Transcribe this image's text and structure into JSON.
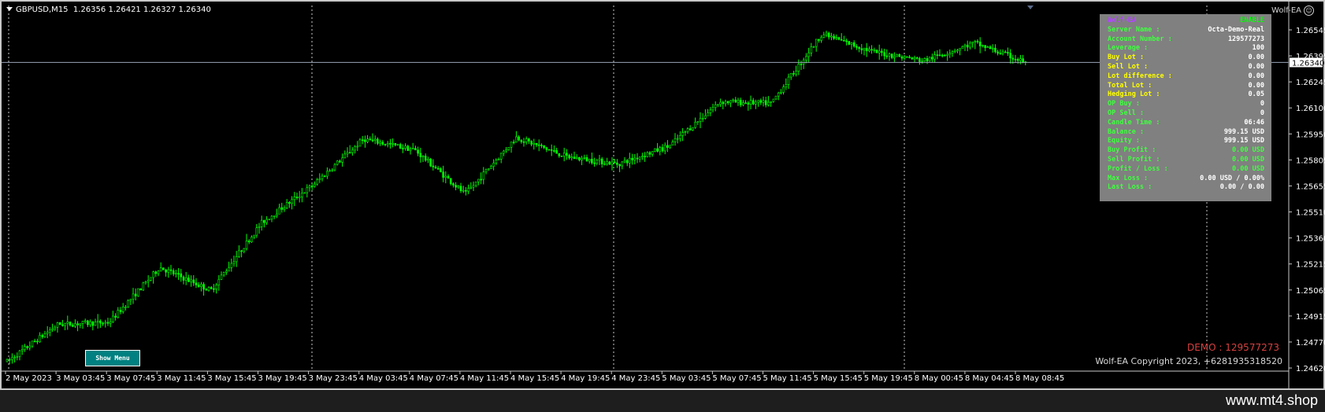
{
  "chart_header": {
    "symbol": "GBPUSD,M15",
    "ohlc": "1.26356 1.26421 1.26327 1.26340"
  },
  "ea_tag": {
    "label": "Wolf-EA",
    "icon": "smiley-icon"
  },
  "colors": {
    "background": "#000000",
    "candle": "#00ff00",
    "grid": "#c8c8c8",
    "bid_line": "#9aa5b8",
    "panel_bg": "#808080",
    "menu_button_bg": "#008080",
    "demo_text": "#d84040"
  },
  "info_panel": {
    "rows": [
      {
        "label": "Wolf-EA",
        "value": "ENABLE",
        "label_color": "#b040ff",
        "value_color": "#00ff00"
      },
      {
        "label": "Server Name :",
        "value": "Octa-Demo-Real",
        "label_color": "#40ff40",
        "value_color": "#ffffff"
      },
      {
        "label": "Account Number :",
        "value": "129577273",
        "label_color": "#40ff40",
        "value_color": "#ffffff"
      },
      {
        "label": "Leverage :",
        "value": "100",
        "label_color": "#40ff40",
        "value_color": "#ffffff"
      },
      {
        "label": "Buy Lot :",
        "value": "0.00",
        "label_color": "#ffff00",
        "value_color": "#ffffff"
      },
      {
        "label": "Sell Lot :",
        "value": "0.00",
        "label_color": "#ffff00",
        "value_color": "#ffffff"
      },
      {
        "label": "Lot difference :",
        "value": "0.00",
        "label_color": "#ffff00",
        "value_color": "#ffffff"
      },
      {
        "label": "Total Lot :",
        "value": "0.00",
        "label_color": "#ffff00",
        "value_color": "#ffffff"
      },
      {
        "label": "Hedging Lot :",
        "value": "0.05",
        "label_color": "#ffff00",
        "value_color": "#ffffff"
      },
      {
        "label": "OP Buy :",
        "value": "0",
        "label_color": "#40ff40",
        "value_color": "#ffffff"
      },
      {
        "label": "OP Sell :",
        "value": "0",
        "label_color": "#40ff40",
        "value_color": "#ffffff"
      },
      {
        "label": "Candle Time :",
        "value": "06:46",
        "label_color": "#40ff40",
        "value_color": "#ffffff"
      },
      {
        "label": "Balance :",
        "value": "999.15 USD",
        "label_color": "#40ff40",
        "value_color": "#ffffff"
      },
      {
        "label": "Equity :",
        "value": "999.15 USD",
        "label_color": "#40ff40",
        "value_color": "#ffffff"
      },
      {
        "label": "Buy Profit :",
        "value": "0.00 USD",
        "label_color": "#40ff40",
        "value_color": "#40ff40"
      },
      {
        "label": "Sell Profit :",
        "value": "0.00 USD",
        "label_color": "#40ff40",
        "value_color": "#40ff40"
      },
      {
        "label": "Profit / Loss :",
        "value": "0.00 USD",
        "label_color": "#40ff40",
        "value_color": "#40ff40"
      },
      {
        "label": "Max Loss :",
        "value": "0.00 USD / 0.00%",
        "label_color": "#40ff40",
        "value_color": "#ffffff"
      },
      {
        "label": "Last Loss :",
        "value": "0.00 / 0.00",
        "label_color": "#40ff40",
        "value_color": "#ffffff"
      }
    ]
  },
  "menu_button": {
    "label": "Show Menu"
  },
  "demo_label": "DEMO : 129577273",
  "copyright": "Wolf-EA Copyright 2023, +6281935318520",
  "footer_url": "www.mt4.shop",
  "price_axis": {
    "ticks": [
      "1.26545",
      "1.26395",
      "1.26245",
      "1.26100",
      "1.25950",
      "1.25805",
      "1.25655",
      "1.25510",
      "1.25360",
      "1.25215",
      "1.25065",
      "1.24915",
      "1.24770",
      "1.24620"
    ],
    "current_price": "1.26340"
  },
  "time_axis": {
    "labels": [
      "2 May 2023",
      "3 May 03:45",
      "3 May 07:45",
      "3 May 11:45",
      "3 May 15:45",
      "3 May 19:45",
      "3 May 23:45",
      "4 May 03:45",
      "4 May 07:45",
      "4 May 11:45",
      "4 May 15:45",
      "4 May 19:45",
      "4 May 23:45",
      "5 May 03:45",
      "5 May 07:45",
      "5 May 11:45",
      "5 May 15:45",
      "5 May 19:45",
      "8 May 00:45",
      "8 May 04:45",
      "8 May 08:45"
    ],
    "day_separators": [
      "3 May 00:00",
      "4 May 00:00",
      "5 May 00:00",
      "8 May 00:00",
      "9 May 00:00"
    ]
  },
  "chart_data": {
    "type": "candlestick",
    "symbol": "GBPUSD",
    "timeframe": "M15",
    "ylim": [
      1.2462,
      1.26545
    ],
    "current_price": 1.2634,
    "x": [
      "2 May 2023",
      "3 May 03:45",
      "3 May 07:45",
      "3 May 11:45",
      "3 May 15:45",
      "3 May 19:45",
      "3 May 23:45",
      "4 May 03:45",
      "4 May 07:45",
      "4 May 11:45",
      "4 May 15:45",
      "4 May 19:45",
      "4 May 23:45",
      "5 May 03:45",
      "5 May 07:45",
      "5 May 11:45",
      "5 May 15:45",
      "5 May 19:45",
      "8 May 00:45",
      "8 May 04:45",
      "8 May 08:45"
    ],
    "close": [
      1.2466,
      1.2487,
      1.2488,
      1.2519,
      1.2506,
      1.2544,
      1.2565,
      1.2591,
      1.2585,
      1.256,
      1.2592,
      1.2581,
      1.2577,
      1.2587,
      1.2612,
      1.2611,
      1.265,
      1.264,
      1.2635,
      1.2645,
      1.2634
    ],
    "high": [
      1.2469,
      1.249,
      1.2522,
      1.2512,
      1.2543,
      1.2575,
      1.2578,
      1.2595,
      1.2596,
      1.2594,
      1.26,
      1.259,
      1.259,
      1.2606,
      1.2636,
      1.2621,
      1.2655,
      1.265,
      1.2644,
      1.2658,
      1.2658
    ],
    "low": [
      1.2462,
      1.247,
      1.248,
      1.2484,
      1.2503,
      1.2538,
      1.256,
      1.2578,
      1.2568,
      1.255,
      1.2572,
      1.2574,
      1.2572,
      1.258,
      1.2602,
      1.256,
      1.263,
      1.2627,
      1.263,
      1.263,
      1.2631
    ]
  }
}
